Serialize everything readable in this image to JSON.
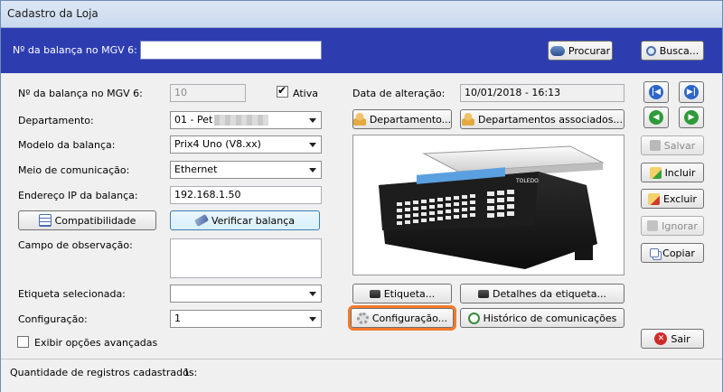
{
  "window": {
    "title": "Cadastro da Loja"
  },
  "search": {
    "label": "Nº da balança no MGV 6:",
    "value": "",
    "procurar_label": "Procurar",
    "busca_label": "Busca..."
  },
  "form": {
    "balanca_label": "Nº da balança no MGV 6:",
    "balanca_value": "10",
    "ativa_label": "Ativa",
    "ativa_checked": true,
    "departamento_label": "Departamento:",
    "departamento_value": "01 - Pet",
    "modelo_label": "Modelo da balança:",
    "modelo_value": "Prix4 Uno (V8.xx)",
    "meio_label": "Meio de comunicação:",
    "meio_value": "Ethernet",
    "ip_label": "Endereço IP da balança:",
    "ip_value": "192.168.1.50",
    "compat_label": "Compatibilidade",
    "verificar_label": "Verificar balança",
    "obs_label": "Campo de observação:",
    "etiqueta_label": "Etiqueta selecionada:",
    "etiqueta_value": "",
    "config_label": "Configuração:",
    "config_value": "1",
    "avancadas_label": "Exibir opções avançadas",
    "avancadas_checked": false
  },
  "right": {
    "data_alteracao_label": "Data de alteração:",
    "data_alteracao_value": "10/01/2018 - 16:13",
    "departamento_btn": "Departamento...",
    "deps_associados_btn": "Departamentos associados...",
    "etiqueta_btn": "Etiqueta...",
    "detalhes_btn": "Detalhes da etiqueta...",
    "configuracao_btn": "Configuração...",
    "historico_btn": "Histórico de comunicações",
    "scale_brand": "TOLEDO"
  },
  "actions": {
    "salvar": "Salvar",
    "incluir": "Incluir",
    "excluir": "Excluir",
    "ignorar": "Ignorar",
    "copiar": "Copiar",
    "sair": "Sair"
  },
  "status": {
    "label": "Quantidade de registros cadastrados:",
    "value": "1"
  },
  "colors": {
    "search_bar": "#2d3db0",
    "highlight": "#f47a2a"
  }
}
